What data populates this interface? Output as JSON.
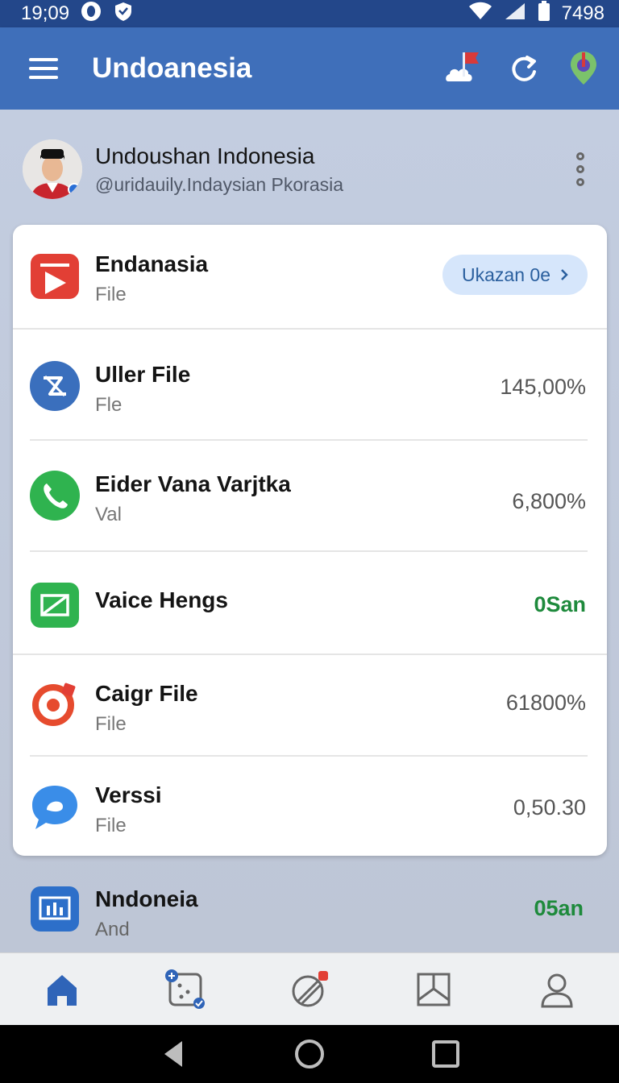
{
  "status_bar": {
    "time": "19;09",
    "right_text": "7498"
  },
  "app_bar": {
    "title": "Undoanesia"
  },
  "profile": {
    "name": "Undoushan Indonesia",
    "handle": "@uridauily.Indaysian Pkorasia"
  },
  "featured": {
    "title": "Endanasia",
    "subtitle": "File",
    "action_label": "Ukazan 0e",
    "action_icon": "chevron-right-icon"
  },
  "rows": [
    {
      "title": "Uller File",
      "subtitle": "Fle",
      "value": "145,00%",
      "icon": "link-off-icon",
      "color": "#3a6fbd"
    },
    {
      "title": "Eider Vana Varjtka",
      "subtitle": "Val",
      "value": "6,800%",
      "icon": "phone-icon",
      "color": "#2fb34f"
    },
    {
      "title": "Vaice Hengs",
      "subtitle": "",
      "value": "0San",
      "icon": "crop-icon",
      "color": "#2fb34f",
      "value_color": "#1e8a3c"
    },
    {
      "title": "Caigr File",
      "subtitle": "File",
      "value": "61800%",
      "icon": "target-icon",
      "color": "#e64b2e"
    },
    {
      "title": "Verssi",
      "subtitle": "File",
      "value": "0,50.30",
      "icon": "chat-bubble-icon",
      "color": "#3a8de8"
    }
  ],
  "outside_row": {
    "title": "Nndoneia",
    "subtitle": "And",
    "value": "05an",
    "icon": "chart-board-icon",
    "color": "#2d6fc9"
  },
  "bottom_nav": [
    {
      "name": "home",
      "icon": "home-icon"
    },
    {
      "name": "dice",
      "icon": "dice-icon"
    },
    {
      "name": "tools",
      "icon": "pencil-slash-icon"
    },
    {
      "name": "gallery",
      "icon": "image-frame-icon"
    },
    {
      "name": "profile",
      "icon": "person-icon"
    }
  ],
  "colors": {
    "app_bar": "#3f6fba",
    "status_bar": "#23478a",
    "accent_green": "#1e8a3c",
    "pill_bg": "#d6e6fb"
  }
}
